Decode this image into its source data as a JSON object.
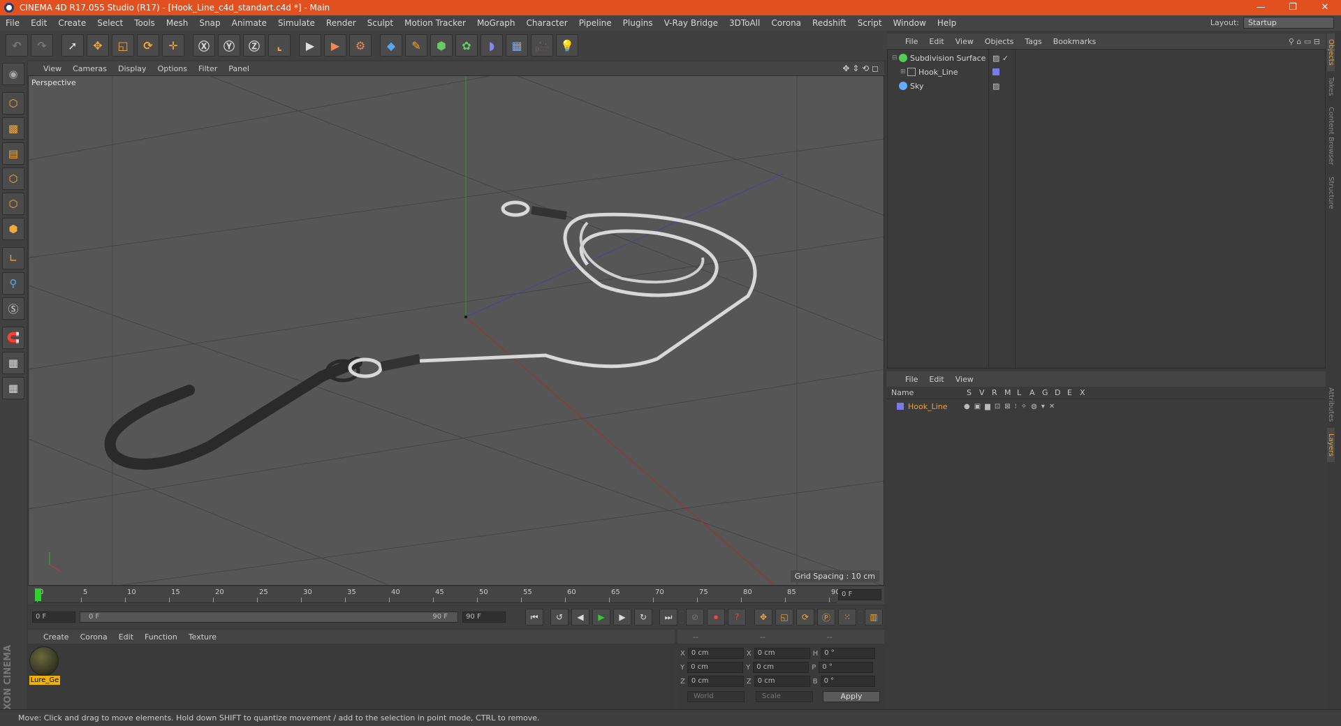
{
  "window": {
    "title": "CINEMA 4D R17.055 Studio (R17) - [Hook_Line_c4d_standart.c4d *] - Main"
  },
  "menubar": [
    "File",
    "Edit",
    "Create",
    "Select",
    "Tools",
    "Mesh",
    "Snap",
    "Animate",
    "Simulate",
    "Render",
    "Sculpt",
    "Motion Tracker",
    "MoGraph",
    "Character",
    "Pipeline",
    "Plugins",
    "V-Ray Bridge",
    "3DToAll",
    "Corona",
    "Redshift",
    "Script",
    "Window",
    "Help"
  ],
  "layout": {
    "label": "Layout:",
    "value": "Startup"
  },
  "viewport": {
    "menu": [
      "View",
      "Cameras",
      "Display",
      "Options",
      "Filter",
      "Panel"
    ],
    "camera": "Perspective",
    "grid_spacing": "Grid Spacing : 10 cm"
  },
  "timeline": {
    "ticks": [
      "0",
      "5",
      "10",
      "15",
      "20",
      "25",
      "30",
      "35",
      "40",
      "45",
      "50",
      "55",
      "60",
      "65",
      "70",
      "75",
      "80",
      "85",
      "90"
    ],
    "current": "0 F",
    "start": "0 F",
    "range_start": "0 F",
    "range_end": "90 F",
    "end": "90 F"
  },
  "materials": {
    "menu": [
      "Create",
      "Corona",
      "Edit",
      "Function",
      "Texture"
    ],
    "items": [
      {
        "label": "Lure_Ge"
      }
    ]
  },
  "coords": {
    "head": [
      "--",
      "--",
      "--"
    ],
    "rows": [
      {
        "a": "X",
        "av": "0 cm",
        "b": "X",
        "bv": "0 cm",
        "c": "H",
        "cv": "0 °"
      },
      {
        "a": "Y",
        "av": "0 cm",
        "b": "Y",
        "bv": "0 cm",
        "c": "P",
        "cv": "0 °"
      },
      {
        "a": "Z",
        "av": "0 cm",
        "b": "Z",
        "bv": "0 cm",
        "c": "B",
        "cv": "0 °"
      }
    ],
    "mode1": "World",
    "mode2": "Scale",
    "apply": "Apply"
  },
  "objects": {
    "menu": [
      "File",
      "Edit",
      "View",
      "Objects",
      "Tags",
      "Bookmarks"
    ],
    "items": [
      {
        "name": "Subdivision Surface"
      },
      {
        "name": "Hook_Line"
      },
      {
        "name": "Sky"
      }
    ]
  },
  "layers": {
    "menu": [
      "File",
      "Edit",
      "View"
    ],
    "columns": [
      "Name",
      "S",
      "V",
      "R",
      "M",
      "L",
      "A",
      "G",
      "D",
      "E",
      "X"
    ],
    "items": [
      {
        "name": "Hook_Line"
      }
    ]
  },
  "sidetabs": [
    "Objects",
    "Takes",
    "Content Browser",
    "Structure",
    "Attributes",
    "Layers"
  ],
  "status": "Move: Click and drag to move elements. Hold down SHIFT to quantize movement / add to the selection in point mode, CTRL to remove.",
  "colors": {
    "titlebar": "#e2501f",
    "accent": "#f2a93b",
    "viewport_bg": "#565656"
  }
}
